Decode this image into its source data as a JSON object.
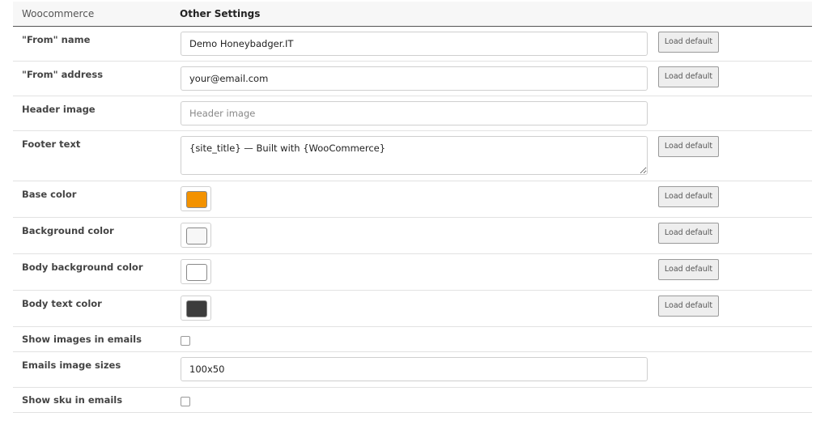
{
  "header": {
    "section_label": "Woocommerce",
    "title": "Other Settings"
  },
  "rows": {
    "from_name": {
      "label": "\"From\" name",
      "value": "Demo Honeybadger.IT",
      "button": "Load default"
    },
    "from_address": {
      "label": "\"From\" address",
      "value": "your@email.com",
      "button": "Load default"
    },
    "header_image": {
      "label": "Header image",
      "value": "",
      "placeholder": "Header image"
    },
    "footer_text": {
      "label": "Footer text",
      "value": "{site_title} — Built with {WooCommerce}",
      "button": "Load default"
    },
    "base_color": {
      "label": "Base color",
      "color": "#f39200",
      "button": "Load default"
    },
    "background_color": {
      "label": "Background color",
      "color": "#f7f7f7",
      "button": "Load default"
    },
    "body_background_color": {
      "label": "Body background color",
      "color": "#ffffff",
      "button": "Load default"
    },
    "body_text_color": {
      "label": "Body text color",
      "color": "#3c3c3c",
      "button": "Load default"
    },
    "show_images": {
      "label": "Show images in emails",
      "checked": false
    },
    "image_sizes": {
      "label": "Emails image sizes",
      "value": "100x50"
    },
    "show_sku": {
      "label": "Show sku in emails",
      "checked": false
    }
  }
}
